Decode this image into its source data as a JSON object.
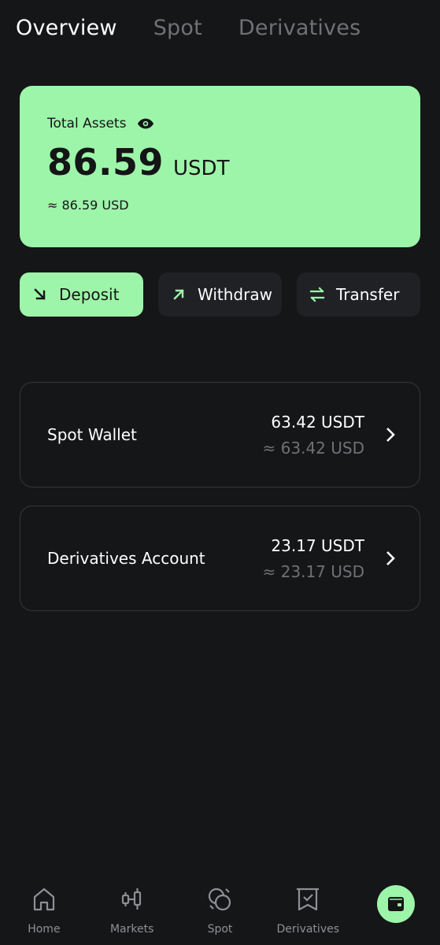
{
  "tabs": [
    {
      "label": "Overview",
      "active": true
    },
    {
      "label": "Spot",
      "active": false
    },
    {
      "label": "Derivatives",
      "active": false
    }
  ],
  "assets": {
    "label": "Total Assets",
    "value": "86.59",
    "unit": "USDT",
    "approx": "≈ 86.59 USD",
    "card_color": "#9df5a9"
  },
  "actions": [
    {
      "label": "Deposit",
      "icon": "arrow-down-right-icon"
    },
    {
      "label": "Withdraw",
      "icon": "arrow-up-right-icon"
    },
    {
      "label": "Transfer",
      "icon": "swap-icon"
    }
  ],
  "accounts": [
    {
      "name": "Spot Wallet",
      "usdt": "63.42 USDT",
      "usd": "≈ 63.42 USD"
    },
    {
      "name": "Derivatives Account",
      "usdt": "23.17 USDT",
      "usd": "≈ 23.17 USD"
    }
  ],
  "nav": [
    {
      "label": "Home",
      "icon": "home-icon"
    },
    {
      "label": "Markets",
      "icon": "candlestick-icon"
    },
    {
      "label": "Spot",
      "icon": "spot-exchange-icon"
    },
    {
      "label": "Derivatives",
      "icon": "derivatives-icon"
    },
    {
      "label": "",
      "icon": "wallet-icon",
      "active": true
    }
  ],
  "colors": {
    "background": "#151618",
    "accent": "#9df5a9",
    "muted_text": "#6f7175"
  }
}
